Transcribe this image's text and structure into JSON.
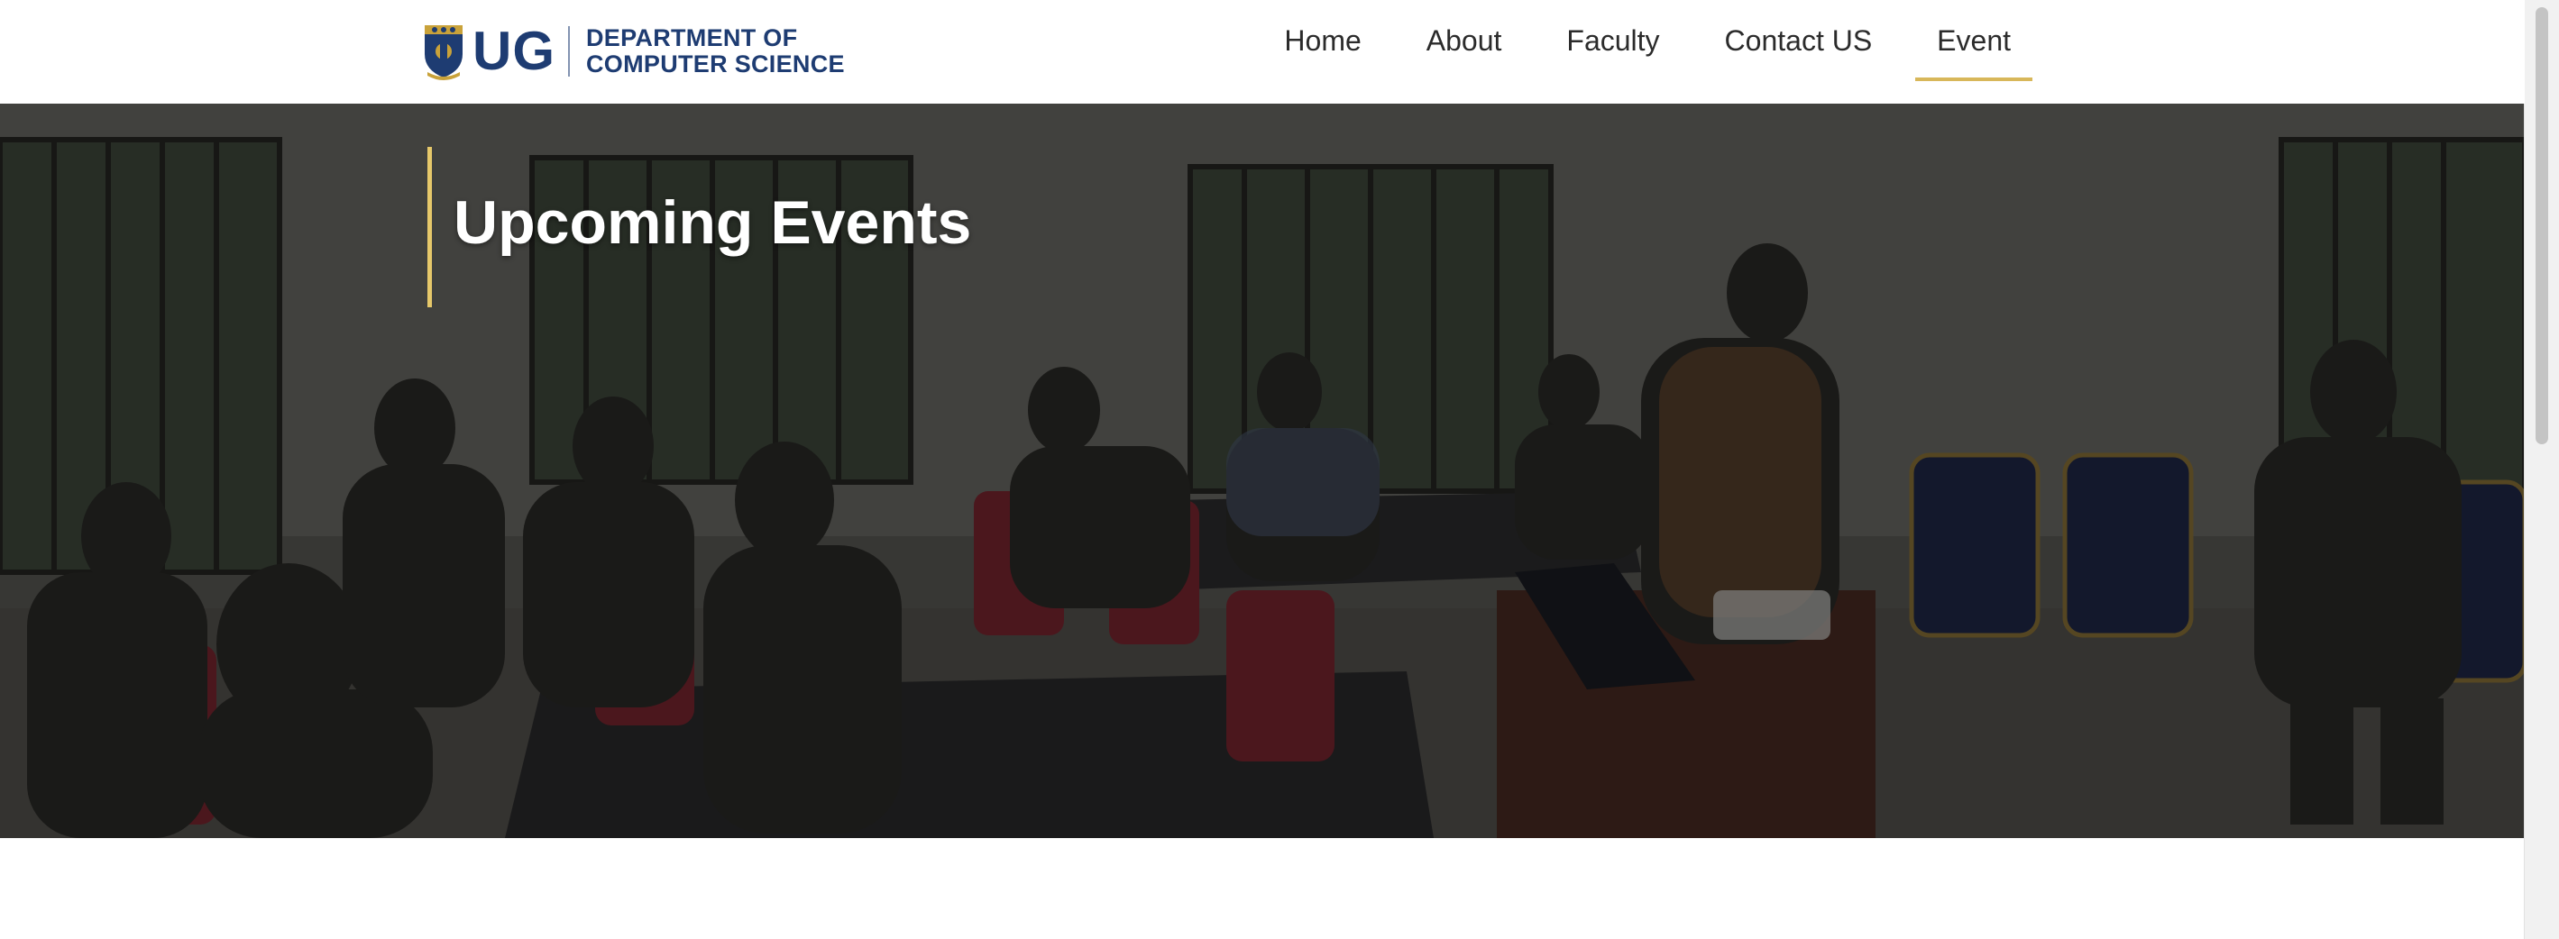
{
  "brand": {
    "short": "UG",
    "line1": "DEPARTMENT OF",
    "line2": "COMPUTER SCIENCE",
    "crest_icon": "university-crest-icon",
    "color": "#1e3c72"
  },
  "nav": {
    "items": [
      {
        "label": "Home",
        "active": false
      },
      {
        "label": "About",
        "active": false
      },
      {
        "label": "Faculty",
        "active": false
      },
      {
        "label": "Contact US",
        "active": false
      },
      {
        "label": "Event",
        "active": true
      }
    ],
    "active_underline_color": "#d8b75a"
  },
  "hero": {
    "title": "Upcoming Events",
    "accent_color": "#e6c86a"
  }
}
